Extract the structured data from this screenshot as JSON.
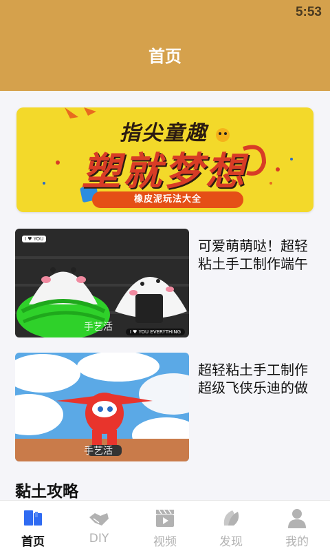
{
  "status_bar": {
    "time": "5:53"
  },
  "header": {
    "title": "首页"
  },
  "banner": {
    "line1": "指尖童趣",
    "line2": "塑就梦想",
    "pill": "橡皮泥玩法大全"
  },
  "articles": [
    {
      "title": "可爱萌萌哒！超轻粘土手工制作端午",
      "watermark": "手艺活",
      "badge_top": "I ♥ YOU",
      "badge_bottom": "I ♥ YOU EVERYTHING"
    },
    {
      "title": "超轻粘土手工制作超级飞侠乐迪的做",
      "watermark": "手艺活"
    }
  ],
  "section": {
    "title": "黏土攻略"
  },
  "tabbar": {
    "active_color": "#2f6bf2",
    "inactive_color": "#b2b2b2",
    "tabs": [
      {
        "label": "首页",
        "icon": "home-book-icon",
        "active": true
      },
      {
        "label": "DIY",
        "icon": "handshake-icon",
        "active": false
      },
      {
        "label": "视频",
        "icon": "video-clapper-icon",
        "active": false
      },
      {
        "label": "发现",
        "icon": "discover-leaf-icon",
        "active": false
      },
      {
        "label": "我的",
        "icon": "user-icon",
        "active": false
      }
    ]
  }
}
